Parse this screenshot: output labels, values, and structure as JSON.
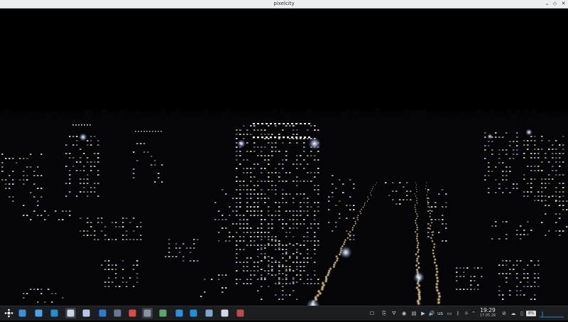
{
  "window": {
    "title": "pixelcity",
    "controls": [
      "chevron-down-icon",
      "maximize-icon",
      "close-icon"
    ]
  },
  "scene": {
    "description_colors": {
      "sky": "#000000",
      "window_light": "#f3f0e6",
      "street_light": "#fff6d0",
      "accent_blue": "#cfe0ff"
    }
  },
  "taskbar": {
    "launcher_icon": "app-launcher-icon",
    "apps": [
      {
        "icon": "folder-blue-icon"
      },
      {
        "icon": "file-manager-icon"
      },
      {
        "icon": "edge-browser-icon"
      },
      {
        "icon": "monitor-icon",
        "active": true
      },
      {
        "icon": "presentation-icon"
      },
      {
        "icon": "store-icon"
      },
      {
        "icon": "circle-app-icon"
      },
      {
        "icon": "calendar-icon"
      },
      {
        "icon": "pixelcity-app-icon",
        "active": true
      },
      {
        "icon": "image-viewer-icon"
      },
      {
        "icon": "globe-icon"
      },
      {
        "icon": "edge-browser-icon"
      },
      {
        "icon": "settings-icon"
      },
      {
        "icon": "x-app-icon"
      },
      {
        "icon": "text-editor-icon"
      }
    ],
    "tray": {
      "keyboard_layout": "us",
      "time": "19:29",
      "date": "17.05.26",
      "battery": "8%"
    }
  }
}
